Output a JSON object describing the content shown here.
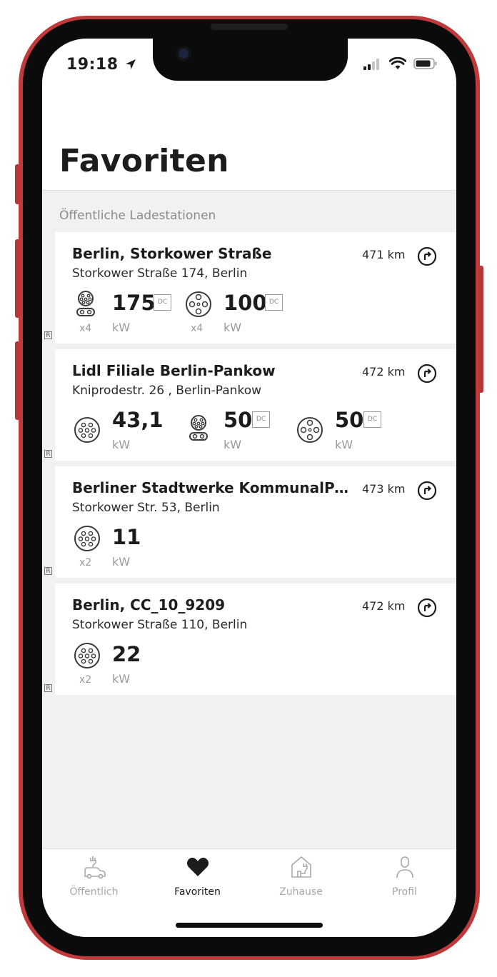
{
  "status_bar": {
    "time": "19:18"
  },
  "page": {
    "title": "Favoriten",
    "section_label": "Öffentliche Ladestationen"
  },
  "stations": [
    {
      "name": "Berlin, Storkower Straße",
      "address": "Storkower Straße 174, Berlin",
      "distance": "471 km",
      "badge": "R",
      "connectors": [
        {
          "icon": "ccs-connector-icon",
          "count": "x4",
          "power": "175",
          "unit": "kW",
          "dc": "DC"
        },
        {
          "icon": "chademo-connector-icon",
          "count": "x4",
          "power": "100",
          "unit": "kW",
          "dc": "DC"
        }
      ]
    },
    {
      "name": "Lidl Filiale Berlin-Pankow",
      "address": "Kniprodestr. 26 , Berlin-Pankow",
      "distance": "472 km",
      "badge": "R",
      "connectors": [
        {
          "icon": "type2-connector-icon",
          "count": "",
          "power": "43,1",
          "unit": "kW",
          "dc": ""
        },
        {
          "icon": "ccs-connector-icon",
          "count": "",
          "power": "50",
          "unit": "kW",
          "dc": "DC"
        },
        {
          "icon": "chademo-connector-icon",
          "count": "",
          "power": "50",
          "unit": "kW",
          "dc": "DC"
        }
      ]
    },
    {
      "name": "Berliner Stadtwerke KommunalPar...",
      "address": "Storkower Str. 53, Berlin",
      "distance": "473 km",
      "badge": "R",
      "connectors": [
        {
          "icon": "type2-connector-icon",
          "count": "x2",
          "power": "11",
          "unit": "kW",
          "dc": ""
        }
      ]
    },
    {
      "name": "Berlin, CC_10_9209",
      "address": "Storkower Straße 110, Berlin",
      "distance": "472 km",
      "badge": "R",
      "connectors": [
        {
          "icon": "type2-connector-icon",
          "count": "x2",
          "power": "22",
          "unit": "kW",
          "dc": ""
        }
      ]
    }
  ],
  "tabs": [
    {
      "label": "Öffentlich",
      "icon": "public-charging-car-icon",
      "active": false
    },
    {
      "label": "Favoriten",
      "icon": "heart-icon",
      "active": true
    },
    {
      "label": "Zuhause",
      "icon": "home-charging-icon",
      "active": false
    },
    {
      "label": "Profil",
      "icon": "person-icon",
      "active": false
    }
  ],
  "colors": {
    "phone_frame": "#c0393b",
    "text": "#1c1c1c",
    "muted": "#9a9a9a",
    "background_grey": "#f1f1f1"
  }
}
